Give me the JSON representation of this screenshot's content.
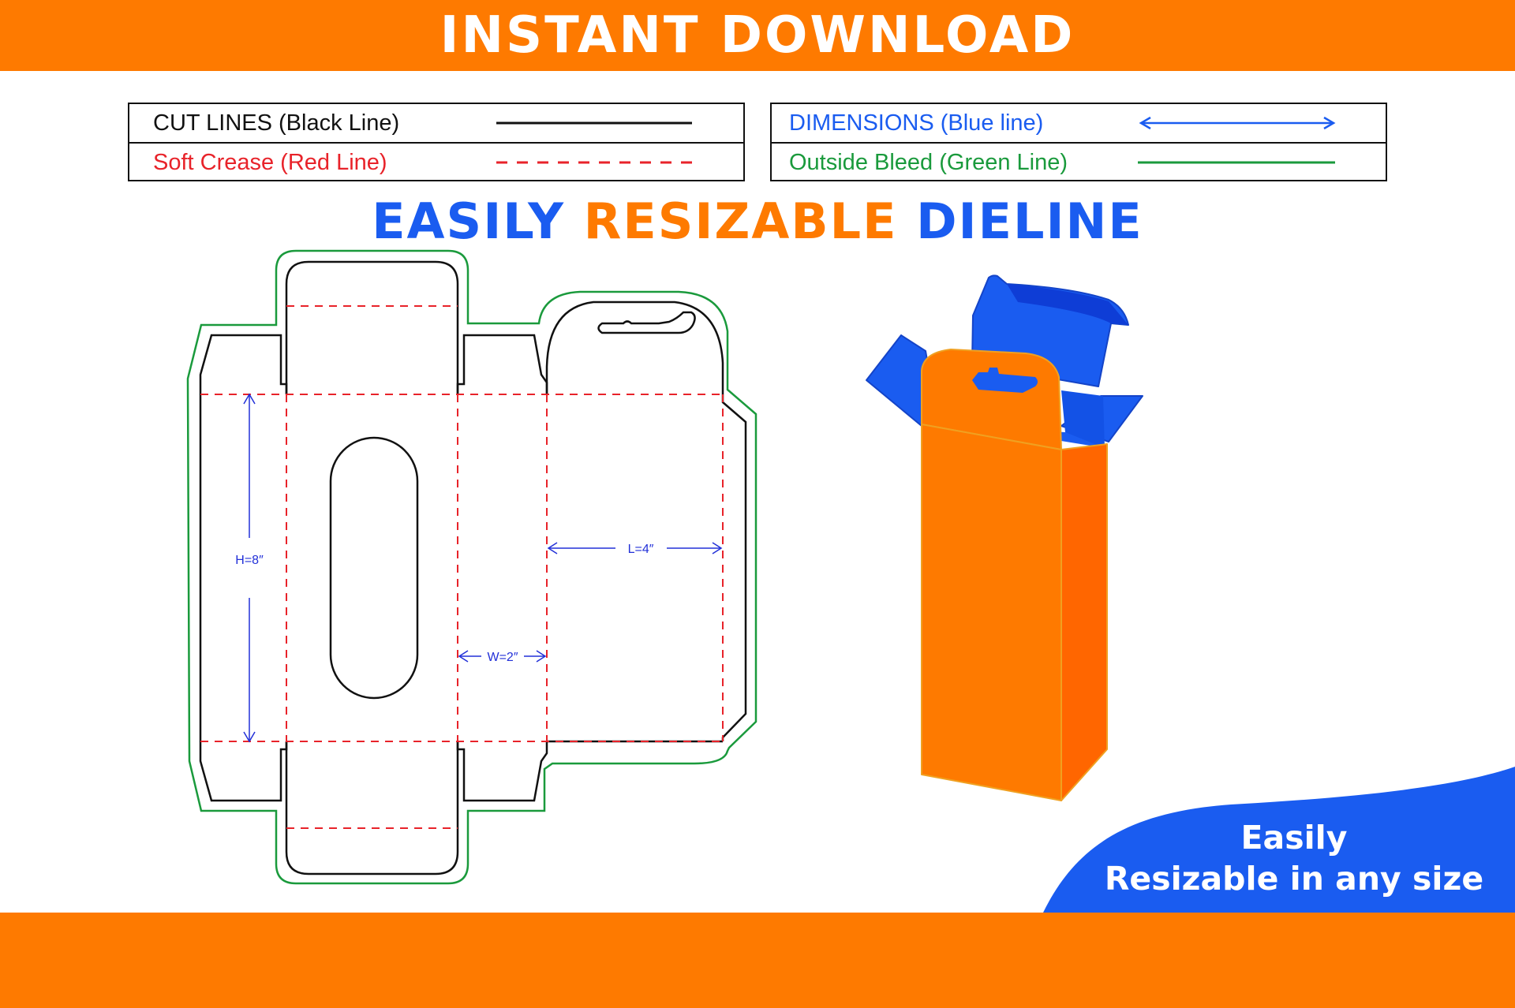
{
  "banner": {
    "title": "INSTANT DOWNLOAD"
  },
  "legend": {
    "cut": "CUT LINES (Black Line)",
    "crease": "Soft Crease (Red Line)",
    "dimensions": "DIMENSIONS (Blue line)",
    "bleed": "Outside Bleed (Green Line)"
  },
  "headline": {
    "part1": "EASILY",
    "part2": "RESIZABLE",
    "part3": "DIELINE"
  },
  "dims": {
    "height": "H=8″",
    "width": "W=2″",
    "length": "L=4″"
  },
  "wave": {
    "line1": "Easily",
    "line2": "Resizable in any size"
  },
  "colors": {
    "orange": "#fe7a00",
    "blue": "#1a5cf0",
    "cut": "#111111",
    "crease": "#e8232a",
    "bleed": "#1a9a3c",
    "dimension": "#2230d8"
  }
}
